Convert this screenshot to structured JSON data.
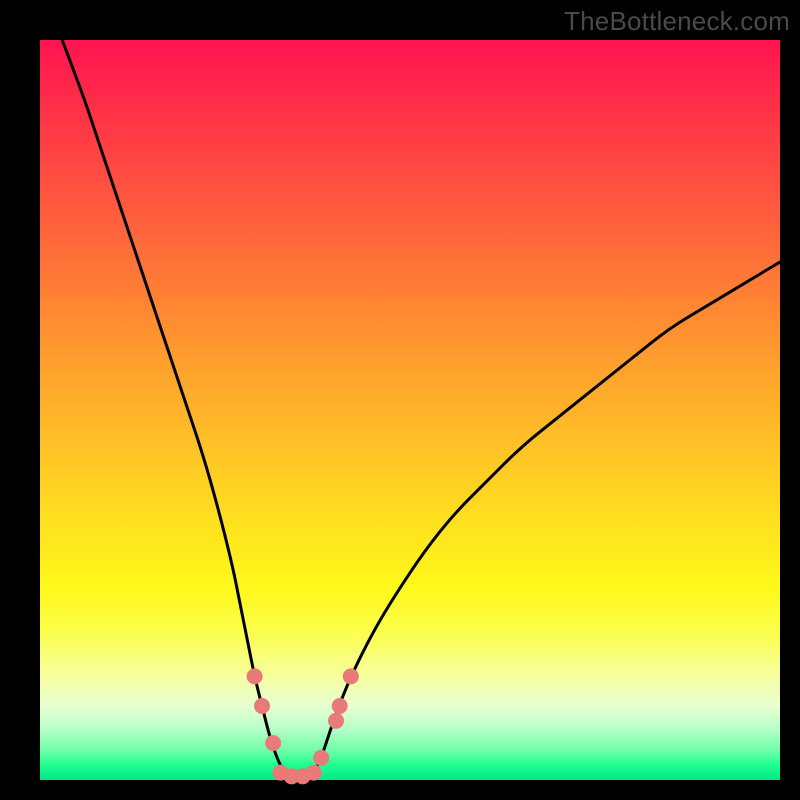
{
  "watermark": "TheBottleneck.com",
  "colors": {
    "background": "#000000",
    "curve": "#000000",
    "markers_fill": "#e87a78",
    "markers_stroke": "#c95a58"
  },
  "chart_data": {
    "type": "line",
    "title": "",
    "xlabel": "",
    "ylabel": "",
    "xlim": [
      0,
      100
    ],
    "ylim": [
      0,
      100
    ],
    "series": [
      {
        "name": "bottleneck-curve",
        "x": [
          3,
          4.5,
          6,
          8,
          10,
          12,
          14,
          16,
          18,
          20,
          22,
          24,
          26,
          27,
          28,
          29,
          30,
          31,
          32,
          33,
          34,
          35,
          36,
          37,
          38,
          39,
          40,
          42,
          45,
          48,
          52,
          56,
          60,
          65,
          70,
          75,
          80,
          85,
          90,
          95,
          100
        ],
        "y": [
          100,
          96,
          92,
          86,
          80,
          74,
          68,
          62,
          56,
          50,
          44,
          37,
          29,
          24,
          19,
          14,
          10,
          6,
          3,
          1,
          0,
          0,
          0,
          1,
          3,
          6,
          9,
          14,
          20,
          25,
          31,
          36,
          40,
          45,
          49,
          53,
          57,
          61,
          64,
          67,
          70
        ]
      }
    ],
    "markers": [
      {
        "x": 29,
        "y": 14
      },
      {
        "x": 30,
        "y": 10
      },
      {
        "x": 31.5,
        "y": 5
      },
      {
        "x": 32.5,
        "y": 1
      },
      {
        "x": 34,
        "y": 0.5
      },
      {
        "x": 35.5,
        "y": 0.5
      },
      {
        "x": 37,
        "y": 1
      },
      {
        "x": 38,
        "y": 3
      },
      {
        "x": 40,
        "y": 8
      },
      {
        "x": 40.5,
        "y": 10
      },
      {
        "x": 42,
        "y": 14
      }
    ]
  }
}
